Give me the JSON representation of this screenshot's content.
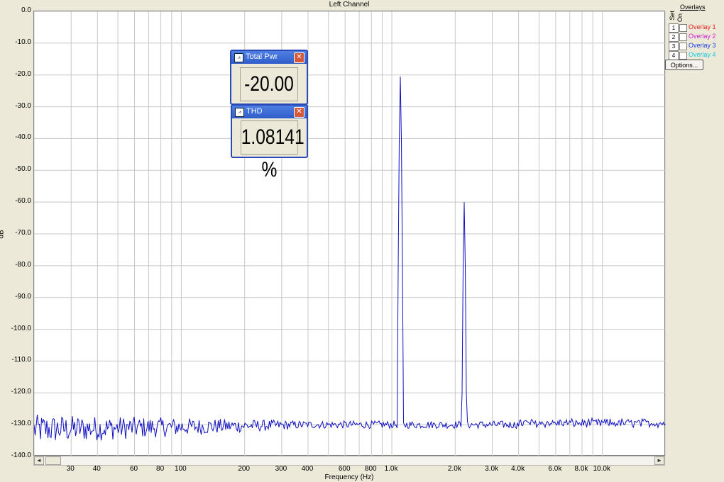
{
  "chart": {
    "title": "Left Channel",
    "xlabel": "Frequency (Hz)",
    "ylabel": "dB"
  },
  "meters": [
    {
      "title": "Total Pwr",
      "value": "-20.00 dB",
      "icon": "meter-icon"
    },
    {
      "title": "THD",
      "value": "1.08141 %",
      "icon": "meter-icon"
    }
  ],
  "overlays": {
    "title": "Overlays",
    "set_header": "Set",
    "on_header": "On",
    "items": [
      {
        "set": "1",
        "label": "Overlay 1",
        "color": "#e02020"
      },
      {
        "set": "2",
        "label": "Overlay 2",
        "color": "#d020d0"
      },
      {
        "set": "3",
        "label": "Overlay 3",
        "color": "#2040e0"
      },
      {
        "set": "4",
        "label": "Overlay 4",
        "color": "#20c8e0"
      }
    ],
    "options_label": "Options..."
  },
  "scrollbar": {
    "left_icon": "scroll-left-icon",
    "right_icon": "scroll-right-icon"
  },
  "chart_data": {
    "type": "line",
    "title": "Left Channel",
    "xlabel": "Frequency (Hz)",
    "ylabel": "dB",
    "x_scale": "log",
    "xlim": [
      20,
      20000
    ],
    "ylim": [
      -140,
      0
    ],
    "grid": true,
    "line_color": "#1010c0",
    "y_ticks": [
      "0.0",
      "-10.0",
      "-20.0",
      "-30.0",
      "-40.0",
      "-50.0",
      "-60.0",
      "-70.0",
      "-80.0",
      "-90.0",
      "-100.0",
      "-110.0",
      "-120.0",
      "-130.0",
      "-140.0"
    ],
    "x_ticks": [
      {
        "v": 30,
        "label": "30"
      },
      {
        "v": 40,
        "label": "40"
      },
      {
        "v": 60,
        "label": "60"
      },
      {
        "v": 80,
        "label": "80"
      },
      {
        "v": 100,
        "label": "100"
      },
      {
        "v": 200,
        "label": "200"
      },
      {
        "v": 300,
        "label": "300"
      },
      {
        "v": 400,
        "label": "400"
      },
      {
        "v": 600,
        "label": "600"
      },
      {
        "v": 800,
        "label": "800"
      },
      {
        "v": 1000,
        "label": "1.0k"
      },
      {
        "v": 2000,
        "label": "2.0k"
      },
      {
        "v": 3000,
        "label": "3.0k"
      },
      {
        "v": 4000,
        "label": "4.0k"
      },
      {
        "v": 6000,
        "label": "6.0k"
      },
      {
        "v": 8000,
        "label": "8.0k"
      },
      {
        "v": 10000,
        "label": "10.0k"
      }
    ],
    "series": [
      {
        "peaks": [
          {
            "x": 1100,
            "y": -20.5
          },
          {
            "x": 2200,
            "y": -60.0
          }
        ],
        "noise_floor_db": -130
      }
    ]
  }
}
